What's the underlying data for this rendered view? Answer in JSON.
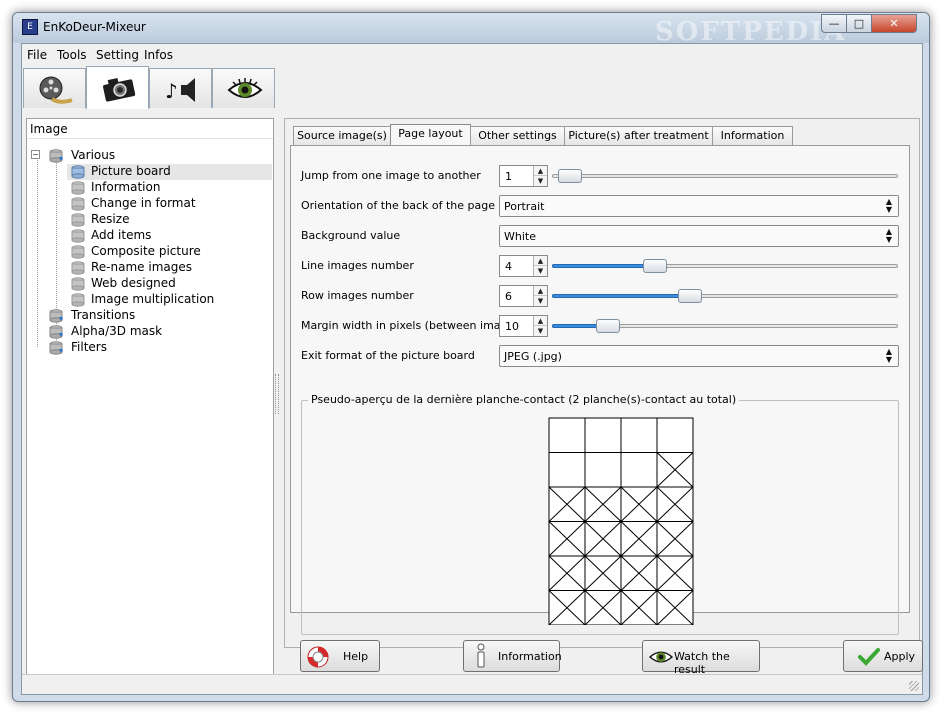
{
  "window": {
    "title": "EnKoDeur-Mixeur",
    "watermark": "SOFTPEDIA"
  },
  "menu": [
    "File",
    "Tools",
    "Setting",
    "Infos"
  ],
  "toolbar_tabs": [
    {
      "icon": "film-reel-icon",
      "active": false
    },
    {
      "icon": "camera-icon",
      "active": true
    },
    {
      "icon": "music-speaker-icon",
      "active": false
    },
    {
      "icon": "eye-icon",
      "active": false
    }
  ],
  "tree": {
    "header": "Image",
    "root": "Various",
    "children": [
      "Picture board",
      "Information",
      "Change in format",
      "Resize",
      "Add items",
      "Composite picture",
      "Re-name images",
      "Web designed",
      "Image multiplication"
    ],
    "siblings": [
      "Transitions",
      "Alpha/3D mask",
      "Filters"
    ],
    "selected": "Picture board"
  },
  "tabs": [
    "Source image(s)",
    "Page layout",
    "Other settings",
    "Picture(s) after treatment",
    "Information"
  ],
  "active_tab": "Page layout",
  "form": {
    "jump": {
      "label": "Jump from one image to another",
      "value": "1",
      "slider": 0.0
    },
    "orientation": {
      "label": "Orientation of the back of the page",
      "value": "Portrait"
    },
    "background": {
      "label": "Background value",
      "value": "White"
    },
    "line_images": {
      "label": "Line images number",
      "value": "4",
      "slider": 0.27
    },
    "row_images": {
      "label": "Row images number",
      "value": "6",
      "slider": 0.38
    },
    "margin": {
      "label": "Margin width in pixels (between images)",
      "value": "10",
      "slider": 0.12
    },
    "exit_format": {
      "label": "Exit format of the picture board",
      "value": "JPEG (.jpg)"
    }
  },
  "preview": {
    "title": "Pseudo-aperçu de la dernière planche-contact (2 planche(s)-contact au total)",
    "columns": 4,
    "rows": 6,
    "empty_cells": 7
  },
  "buttons": {
    "help": "Help",
    "information": "Information",
    "watch": "Watch the result",
    "apply": "Apply"
  },
  "colors": {
    "accent": "#3a8ddc",
    "titlebar": "#bccbdc",
    "apply_check": "#3aa832"
  }
}
